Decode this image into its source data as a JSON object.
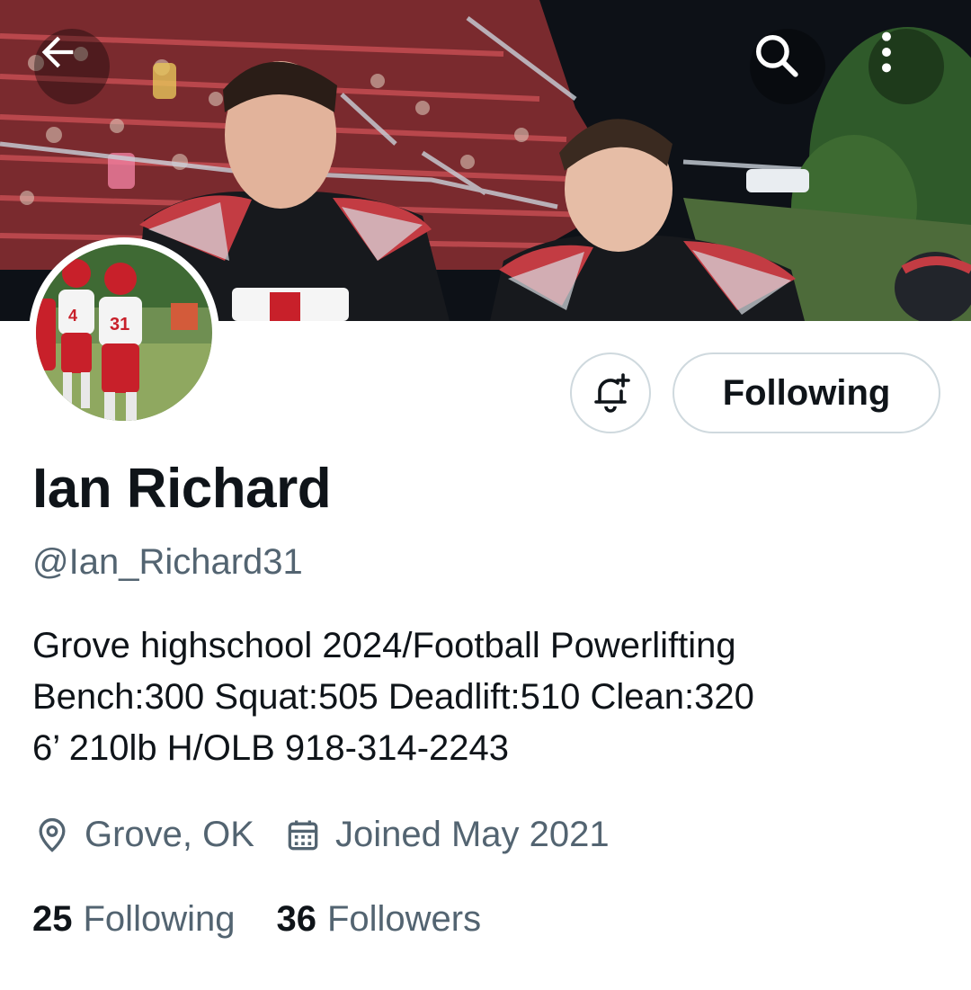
{
  "header": {
    "back_icon": "arrow-left-icon",
    "search_icon": "search-icon",
    "more_icon": "more-vertical-icon"
  },
  "profile": {
    "name": "Ian Richard",
    "handle": "@Ian_Richard31",
    "bio_lines": [
      "Grove highschool 2024/Football Powerlifting",
      "Bench:300 Squat:505 Deadlift:510 Clean:320",
      "6’ 210lb H/OLB 918-314-2243"
    ],
    "location": "Grove, OK",
    "joined": "Joined May 2021"
  },
  "actions": {
    "notify_icon": "bell-plus-icon",
    "following_label": "Following"
  },
  "stats": {
    "following_count": "25",
    "following_label": "Following",
    "followers_count": "36",
    "followers_label": "Followers"
  },
  "colors": {
    "primary_text": "#0f1419",
    "secondary_text": "#536471",
    "border": "#cfd9de",
    "jersey_red": "#c8202a"
  }
}
